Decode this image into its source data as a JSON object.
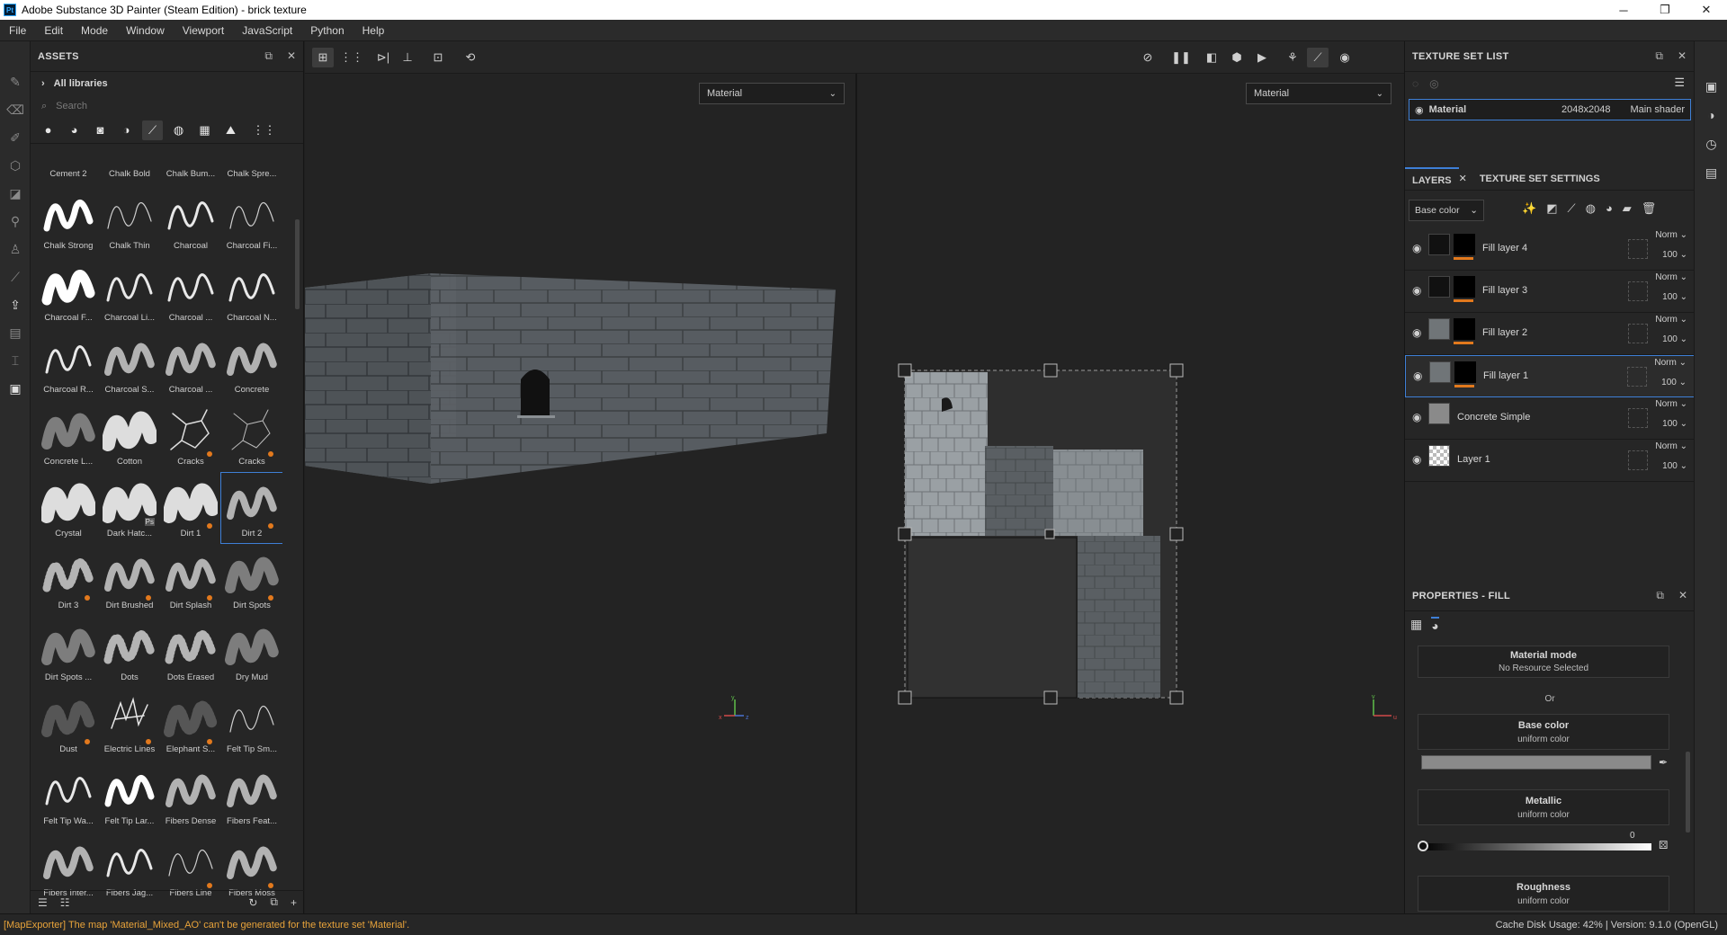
{
  "titlebar": {
    "icon": "Pt",
    "title": "Adobe Substance 3D Painter (Steam Edition) - brick texture",
    "minimize": "─",
    "maximize": "❐",
    "close": "✕"
  },
  "menu": [
    "File",
    "Edit",
    "Mode",
    "Window",
    "Viewport",
    "JavaScript",
    "Python",
    "Help"
  ],
  "assets": {
    "title": "ASSETS",
    "all_libraries": "All libraries",
    "search_placeholder": "Search",
    "top_row": [
      "Cement 2",
      "Chalk Bold",
      "Chalk Bum...",
      "Chalk Spre..."
    ],
    "items": [
      {
        "label": "Chalk Strong",
        "style": "thick"
      },
      {
        "label": "Chalk Thin",
        "style": "thin"
      },
      {
        "label": "Charcoal",
        "style": "medium"
      },
      {
        "label": "Charcoal Fi...",
        "style": "thin"
      },
      {
        "label": "Charcoal F...",
        "style": "bold"
      },
      {
        "label": "Charcoal Li...",
        "style": "medium"
      },
      {
        "label": "Charcoal ...",
        "style": "medium"
      },
      {
        "label": "Charcoal N...",
        "style": "medium"
      },
      {
        "label": "Charcoal R...",
        "style": "medium"
      },
      {
        "label": "Charcoal S...",
        "style": "rough"
      },
      {
        "label": "Charcoal ...",
        "style": "rough"
      },
      {
        "label": "Concrete",
        "style": "rough"
      },
      {
        "label": "Concrete L...",
        "style": "soft"
      },
      {
        "label": "Cotton",
        "style": "blob"
      },
      {
        "label": "Cracks",
        "style": "cracks",
        "badge": true
      },
      {
        "label": "Cracks",
        "style": "cracks2",
        "badge": true
      },
      {
        "label": "Crystal",
        "style": "blob"
      },
      {
        "label": "Dark Hatc...",
        "style": "blob",
        "ps": "Ps"
      },
      {
        "label": "Dirt 1",
        "style": "blob",
        "badge": true
      },
      {
        "label": "Dirt 2",
        "style": "rough",
        "badge": true,
        "selected": true
      },
      {
        "label": "Dirt 3",
        "style": "dots",
        "badge": true
      },
      {
        "label": "Dirt Brushed",
        "style": "rough",
        "badge": true
      },
      {
        "label": "Dirt Splash",
        "style": "rough",
        "badge": true
      },
      {
        "label": "Dirt Spots",
        "style": "soft",
        "badge": true
      },
      {
        "label": "Dirt Spots ...",
        "style": "soft"
      },
      {
        "label": "Dots",
        "style": "dots"
      },
      {
        "label": "Dots Erased",
        "style": "dots"
      },
      {
        "label": "Dry Mud",
        "style": "soft"
      },
      {
        "label": "Dust",
        "style": "dust",
        "badge": true
      },
      {
        "label": "Electric Lines",
        "style": "electric",
        "badge": true
      },
      {
        "label": "Elephant S...",
        "style": "dust",
        "badge": true
      },
      {
        "label": "Felt Tip Sm...",
        "style": "thin"
      },
      {
        "label": "Felt Tip Wa...",
        "style": "medium"
      },
      {
        "label": "Felt Tip Lar...",
        "style": "thick"
      },
      {
        "label": "Fibers Dense",
        "style": "rough"
      },
      {
        "label": "Fibers Feat...",
        "style": "rough"
      },
      {
        "label": "Fibers Inter...",
        "style": "rough"
      },
      {
        "label": "Fibers Jag...",
        "style": "medium"
      },
      {
        "label": "Fibers Line",
        "style": "thin",
        "badge": true
      },
      {
        "label": "Fibers Moss",
        "style": "rough",
        "badge": true
      }
    ]
  },
  "viewport": {
    "left_dropdown": "Material",
    "right_dropdown": "Material",
    "axis_labels": [
      "x",
      "y",
      "z",
      "u",
      "v"
    ]
  },
  "texture_set_list": {
    "title": "TEXTURE SET LIST",
    "row": {
      "name": "Material",
      "resolution": "2048x2048",
      "shader": "Main shader"
    }
  },
  "layers": {
    "tab_layers": "LAYERS",
    "tab_settings": "TEXTURE SET SETTINGS",
    "channel": "Base color",
    "rows": [
      {
        "name": "Fill layer 4",
        "blend": "Norm",
        "opacity": "100"
      },
      {
        "name": "Fill layer 3",
        "blend": "Norm",
        "opacity": "100"
      },
      {
        "name": "Fill layer 2",
        "blend": "Norm",
        "opacity": "100"
      },
      {
        "name": "Fill layer 1",
        "blend": "Norm",
        "opacity": "100",
        "selected": true
      },
      {
        "name": "Concrete Simple",
        "blend": "Norm",
        "opacity": "100"
      },
      {
        "name": "Layer 1",
        "blend": "Norm",
        "opacity": "100"
      }
    ]
  },
  "properties": {
    "title": "PROPERTIES - FILL",
    "material_mode": "Material mode",
    "no_resource": "No Resource Selected",
    "or": "Or",
    "base_color": "Base color",
    "base_color_sub": "uniform color",
    "base_color_value": "#8a8a8a",
    "metallic": "Metallic",
    "metallic_sub": "uniform color",
    "metallic_value": "0",
    "roughness": "Roughness",
    "roughness_sub": "uniform color"
  },
  "status": {
    "warning": "[MapExporter] The map 'Material_Mixed_AO' can't be generated for the texture set 'Material'.",
    "right": "Cache Disk Usage:    42% | Version: 9.1.0 (OpenGL)"
  }
}
